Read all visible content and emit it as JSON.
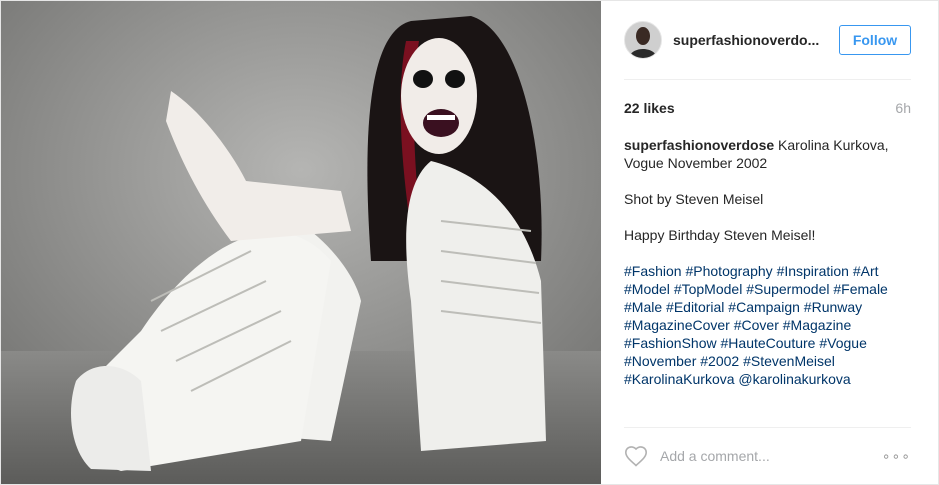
{
  "photo": {
    "icon": "fashion-photo-image"
  },
  "header": {
    "username": "superfashionoverdo...",
    "follow_label": "Follow",
    "avatar_icon": "avatar-icon"
  },
  "meta": {
    "likes": "22 likes",
    "time": "6h"
  },
  "caption": {
    "username": "superfashionoverdose",
    "text": "Karolina Kurkova, Vogue November 2002",
    "line2": "Shot by Steven Meisel",
    "line3": "Happy Birthday Steven Meisel!",
    "tags": [
      "#Fashion",
      "#Photography",
      "#Inspiration",
      "#Art",
      "#Model",
      "#TopModel",
      "#Supermodel",
      "#Female",
      "#Male",
      "#Editorial",
      "#Campaign",
      "#Runway",
      "#MagazineCover",
      "#Cover",
      "#Magazine",
      "#FashionShow",
      "#HauteCouture",
      "#Vogue",
      "#November",
      "#2002",
      "#StevenMeisel",
      "#KarolinaKurkova",
      "@karolinakurkova"
    ]
  },
  "footer": {
    "comment_placeholder": "Add a comment...",
    "more_label": "∘∘∘",
    "heart_icon": "heart-icon",
    "more_icon": "more-options-icon"
  },
  "colors": {
    "link": "#003569",
    "follow": "#3897f0",
    "muted": "#a5a7aa"
  }
}
